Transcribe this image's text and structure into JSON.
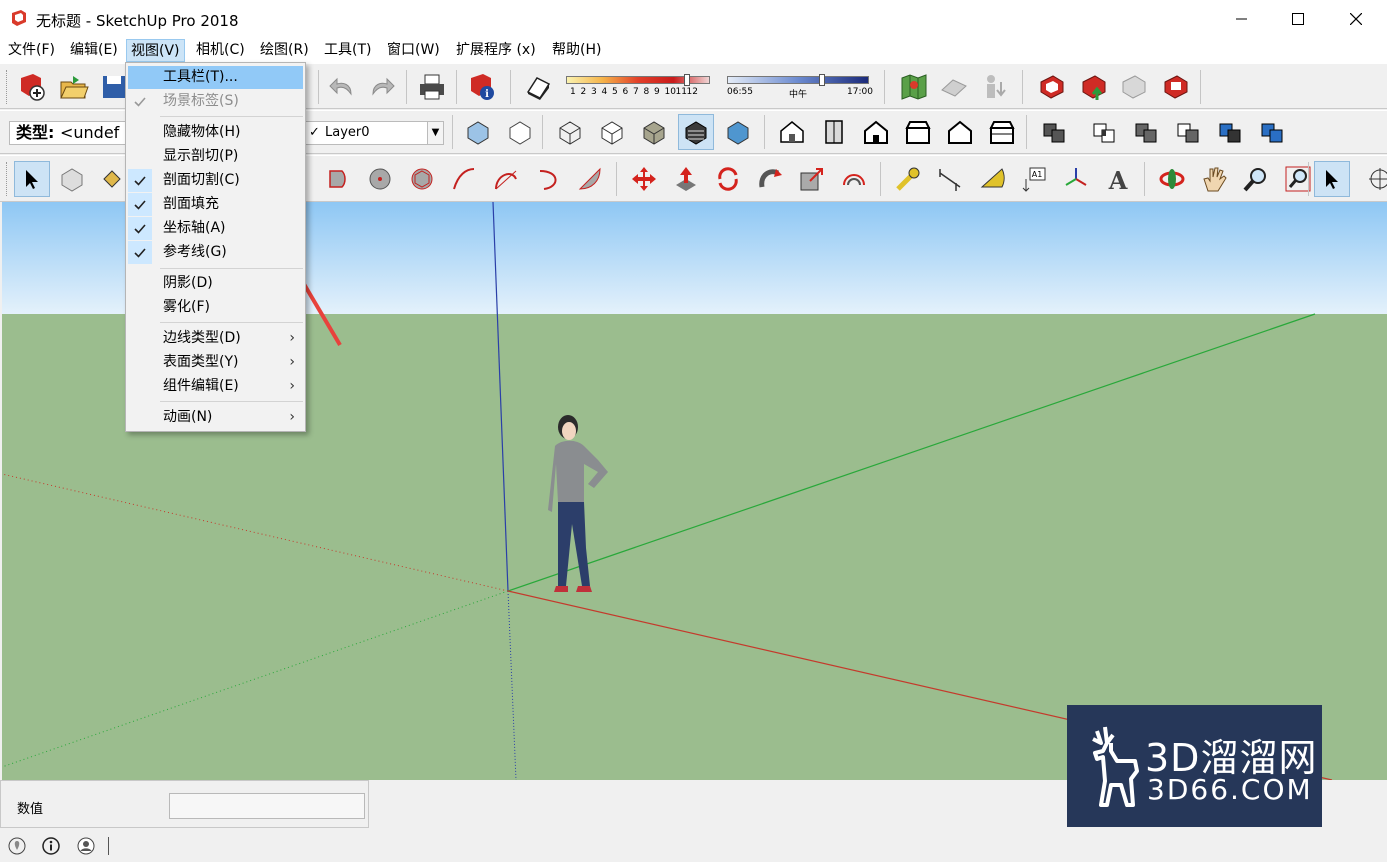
{
  "window": {
    "title": "无标题 - SketchUp Pro 2018",
    "minimize": "—",
    "maximize": "☐",
    "close": "✕"
  },
  "menubar": [
    {
      "label": "文件(F)"
    },
    {
      "label": "编辑(E)"
    },
    {
      "label": "视图(V)"
    },
    {
      "label": "相机(C)"
    },
    {
      "label": "绘图(R)"
    },
    {
      "label": "工具(T)"
    },
    {
      "label": "窗口(W)"
    },
    {
      "label": "扩展程序 (x)"
    },
    {
      "label": "帮助(H)"
    }
  ],
  "view_menu": {
    "items": [
      {
        "label": "工具栏(T)...",
        "checked": false,
        "highlighted": true,
        "disabled": false
      },
      {
        "label": "场景标签(S)",
        "checked": true,
        "highlighted": false,
        "disabled": true
      },
      {
        "label": "隐藏物体(H)",
        "checked": false
      },
      {
        "label": "显示剖切(P)",
        "checked": false
      },
      {
        "label": "剖面切割(C)",
        "checked": true
      },
      {
        "label": "剖面填充",
        "checked": true
      },
      {
        "label": "坐标轴(A)",
        "checked": true
      },
      {
        "label": "参考线(G)",
        "checked": true
      },
      {
        "label": "阴影(D)",
        "checked": false
      },
      {
        "label": "雾化(F)",
        "checked": false
      },
      {
        "label": "边线类型(D)",
        "submenu": true
      },
      {
        "label": "表面类型(Y)",
        "submenu": true
      },
      {
        "label": "组件编辑(E)",
        "submenu": true
      },
      {
        "label": "动画(N)",
        "submenu": true
      }
    ]
  },
  "entity_info": {
    "type_label": "类型:",
    "type_value": "<undef",
    "layer_value": "Layer0"
  },
  "shadow_settings": {
    "month_ticks": [
      "1",
      "2",
      "3",
      "4",
      "5",
      "6",
      "7",
      "8",
      "9",
      "10",
      "11",
      "12"
    ],
    "time_start": "06:55",
    "time_mid": "中午",
    "time_end": "17:00"
  },
  "measurements": {
    "label": "数值",
    "value": ""
  },
  "watermark": {
    "brand_cn": "3D溜溜网",
    "brand_url": "3D66.COM"
  },
  "colors": {
    "sky_top": "#8ec7f4",
    "sky_bottom": "#e4f1fb",
    "ground": "#9bbd8e",
    "axis_red": "#c43a2c",
    "axis_green": "#29a83a",
    "axis_blue": "#2a3fa8",
    "menu_highlight": "#91c9f7",
    "annotation_arrow": "#e8423c"
  }
}
